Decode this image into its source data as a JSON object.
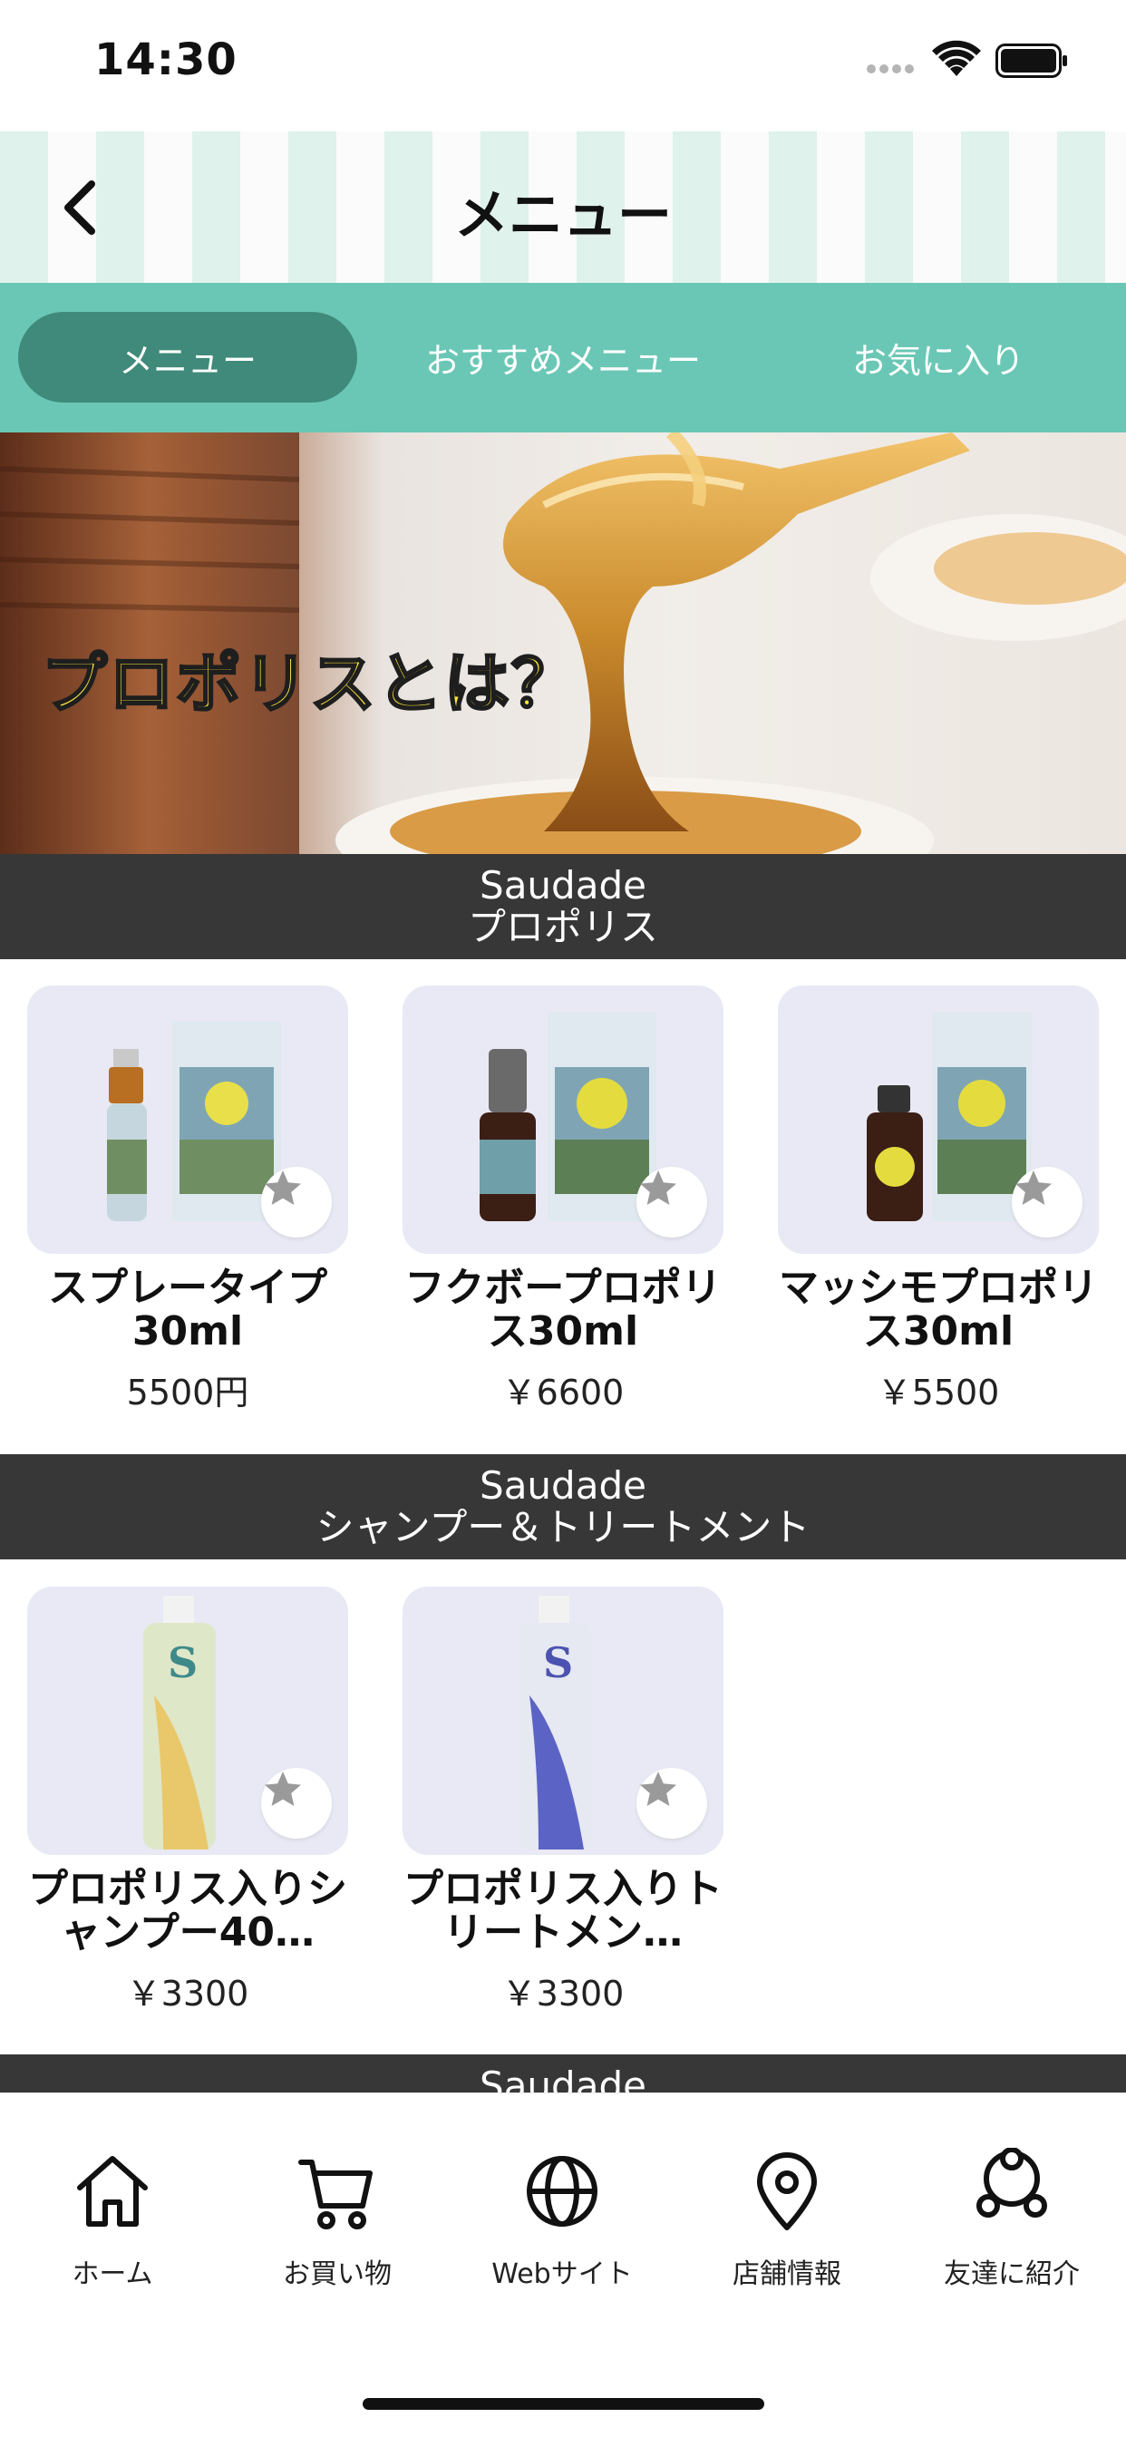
{
  "status_bar": {
    "time": "14:30"
  },
  "header": {
    "title": "メニュー"
  },
  "tabs": [
    {
      "label": "メニュー",
      "active": true
    },
    {
      "label": "おすすめメニュー",
      "active": false
    },
    {
      "label": "お気に入り",
      "active": false
    }
  ],
  "banner": {
    "text": "プロポリスとは？"
  },
  "sections": [
    {
      "title_line1": "Saudade",
      "title_line2": "プロポリス",
      "products": [
        {
          "name": "スプレータイプ30ml",
          "price": "5500円"
        },
        {
          "name": "フクボープロポリス30ml",
          "price": "￥6600"
        },
        {
          "name": "マッシモプロポリス30ml",
          "price": "￥5500"
        }
      ]
    },
    {
      "title_line1": "Saudade",
      "title_line2": "シャンプー＆トリートメント",
      "products": [
        {
          "name": "プロポリス入りシャンプー40…",
          "price": "￥3300"
        },
        {
          "name": "プロポリス入りトリートメン…",
          "price": "￥3300"
        }
      ]
    },
    {
      "title_line1": "Saudade"
    }
  ],
  "bottom_nav": [
    {
      "label": "ホーム",
      "icon": "home-icon"
    },
    {
      "label": "お買い物",
      "icon": "cart-icon"
    },
    {
      "label": "Webサイト",
      "icon": "globe-icon"
    },
    {
      "label": "店舗情報",
      "icon": "location-pin-icon"
    },
    {
      "label": "友達に紹介",
      "icon": "share-icon"
    }
  ],
  "colors": {
    "tab_bar": "#6ac7b5",
    "tab_active": "#3f8a7a",
    "section_header": "#373737",
    "stripe_light": "#dff2ec"
  }
}
